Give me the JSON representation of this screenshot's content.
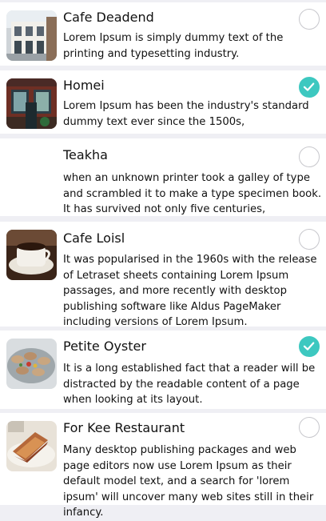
{
  "colors": {
    "selected": "#3dc8c0",
    "unselected": "#c7c7cc",
    "separator": "#efeff4"
  },
  "items": [
    {
      "title": "Cafe Deadend",
      "description": "Lorem Ipsum is simply dummy text of the printing and typesetting industry.",
      "selected": false,
      "image": "cafe-storefront-image"
    },
    {
      "title": "Homei",
      "description": "Lorem Ipsum has been the industry's standard dummy text ever since the 1500s,",
      "selected": true,
      "image": "brick-storefront-image"
    },
    {
      "title": "Teakha",
      "description": "when an unknown printer took a galley of type and scrambled it to make a type specimen book. It has survived not only five centuries,",
      "selected": false,
      "image": null
    },
    {
      "title": "Cafe Loisl",
      "description": "It was popularised in the 1960s with the release of Letraset sheets containing Lorem Ipsum passages, and more recently with desktop publishing software like Aldus PageMaker including versions of Lorem Ipsum.",
      "selected": false,
      "image": "coffee-cup-image"
    },
    {
      "title": "Petite Oyster",
      "description": "It is a long established fact that a reader will be distracted by the readable content of a page when looking at its layout.",
      "selected": true,
      "image": "oyster-platter-image"
    },
    {
      "title": "For Kee Restaurant",
      "description": "Many desktop publishing packages and web page editors now use Lorem Ipsum as their default model text, and a search for 'lorem ipsum' will uncover many web sites still in their infancy.",
      "selected": false,
      "image": "sandwich-image"
    }
  ]
}
